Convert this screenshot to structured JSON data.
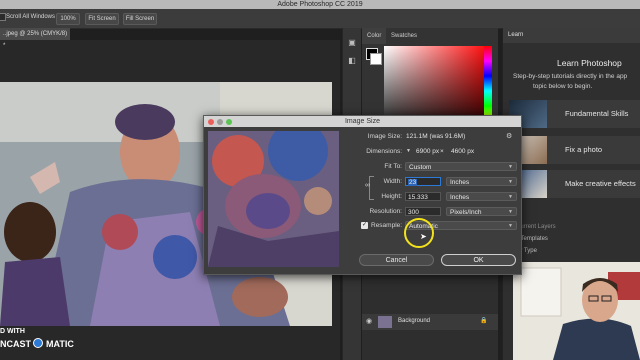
{
  "window": {
    "title": "Adobe Photoshop CC 2019"
  },
  "options_bar": {
    "scroll_all_label": "Scroll All Windows",
    "zoom_label": "100%",
    "fit_screen_label": "Fit Screen",
    "fill_screen_label": "Fill Screen"
  },
  "document": {
    "tab_label": "..jpeg @ 25% (CMYK/8) *"
  },
  "color_panel": {
    "tabs": [
      "Color",
      "Swatches"
    ]
  },
  "learn_panel": {
    "tab": "Learn",
    "title": "Learn Photoshop",
    "description_line1": "Step-by-step tutorials directly in the app",
    "description_line2": "topic below to begin.",
    "cards": [
      {
        "label": "Fundamental Skills"
      },
      {
        "label": "Fix a photo"
      },
      {
        "label": "Make creative effects"
      }
    ],
    "partial_items": [
      "...Current Layers",
      "...k Templates",
      "...by Type"
    ]
  },
  "layers": {
    "layer_name": "Background"
  },
  "dialog": {
    "title": "Image Size",
    "image_size_label": "Image Size:",
    "image_size_value": "121.1M (was 91.6M)",
    "dimensions_label": "Dimensions:",
    "dim_w": "6900 px",
    "dim_x": "×",
    "dim_h": "4600 px",
    "fit_to_label": "Fit To:",
    "fit_to_value": "Custom",
    "width_label": "Width:",
    "width_value": "23",
    "width_unit": "Inches",
    "height_label": "Height:",
    "height_value": "15.333",
    "height_unit": "Inches",
    "resolution_label": "Resolution:",
    "resolution_value": "300",
    "resolution_unit": "Pixels/Inch",
    "resample_label": "Resample:",
    "resample_value": "Automatic",
    "cancel_label": "Cancel",
    "ok_label": "OK"
  },
  "watermark": {
    "line1": "D WITH",
    "brand_left": "NCAST",
    "brand_right": "MATIC"
  },
  "colors": {
    "accent": "#2d7ad6",
    "highlight_ring": "#f2e21c",
    "dialog_bg": "#3d3d3d"
  }
}
